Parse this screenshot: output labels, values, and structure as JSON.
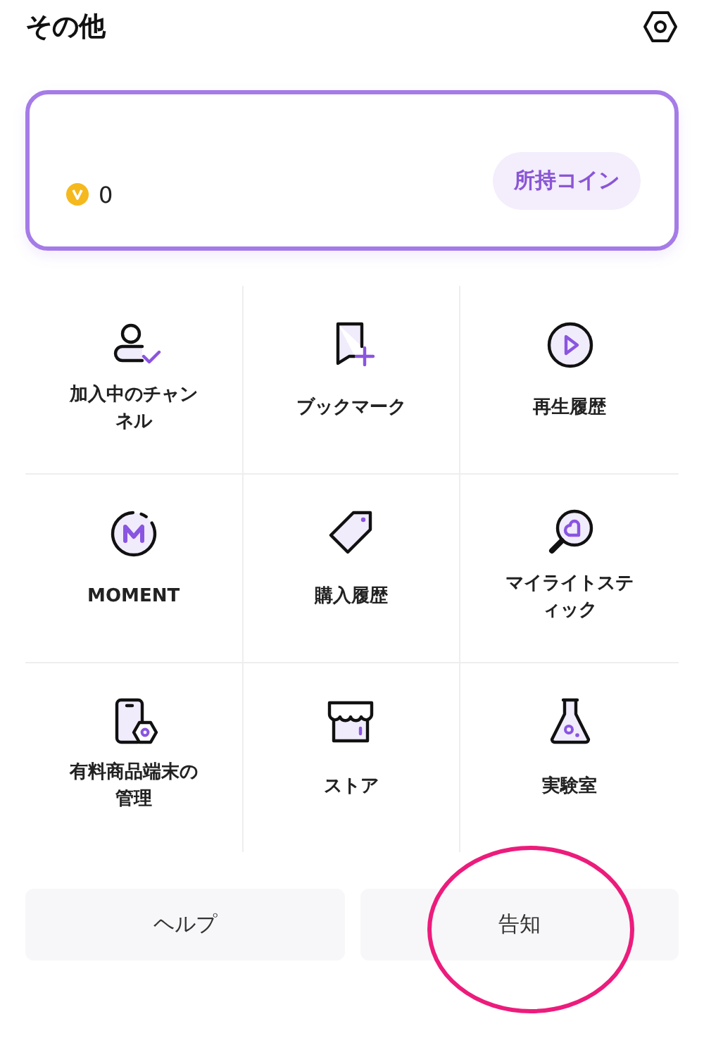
{
  "header": {
    "title": "その他"
  },
  "coin_card": {
    "coins": "0",
    "button": "所持コイン"
  },
  "menu": [
    {
      "kind": "channels",
      "label": "加入中のチャンネル"
    },
    {
      "kind": "bookmark",
      "label": "ブックマーク"
    },
    {
      "kind": "history",
      "label": "再生履歴"
    },
    {
      "kind": "moment",
      "label": "MOMENT"
    },
    {
      "kind": "purchases",
      "label": "購入履歴"
    },
    {
      "kind": "lightstick",
      "label": "マイライトスティック"
    },
    {
      "kind": "devices",
      "label": "有料商品端末の管理"
    },
    {
      "kind": "store",
      "label": "ストア"
    },
    {
      "kind": "lab",
      "label": "実験室"
    }
  ],
  "buttons": [
    {
      "label": "ヘルプ",
      "highlighted": false
    },
    {
      "label": "告知",
      "highlighted": true
    }
  ]
}
